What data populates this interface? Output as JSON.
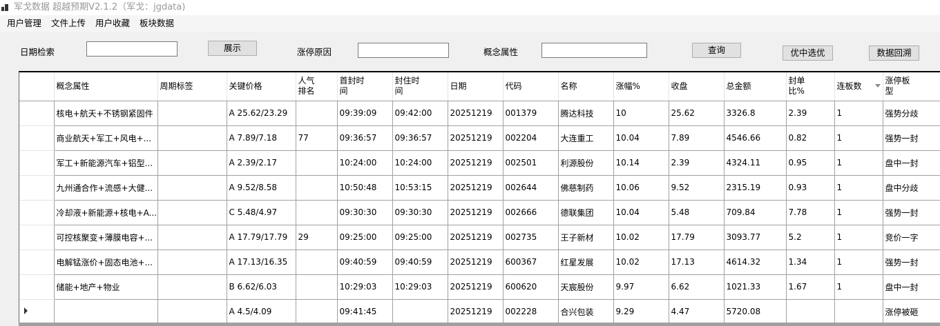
{
  "window": {
    "title": "军戈数据 超越预期V2.1.2（军戈：jgdata)"
  },
  "menu": [
    "用户管理",
    "文件上传",
    "用户收藏",
    "板块数据"
  ],
  "filters": {
    "date_label": "日期检索",
    "date_value": "",
    "show_button": "展示",
    "reason_label": "涨停原因",
    "reason_value": "",
    "concept_label": "概念属性",
    "concept_value": "",
    "query_button": "查询",
    "best_button": "优中选优",
    "backtrack_button": "数据回溯"
  },
  "table": {
    "columns": [
      "概念属性",
      "周期标签",
      "关键价格",
      "人气排名",
      "首封时间",
      "封住时间",
      "日期",
      "代码",
      "名称",
      "涨幅%",
      "收盘",
      "总金额",
      "封单比%",
      "连板数",
      "涨停板型"
    ],
    "sorted_column": "连板数",
    "sort_direction": "descending",
    "rows": [
      [
        "核电+航天+不锈钢紧固件",
        "",
        "A 25.62/23.29",
        "",
        "09:39:09",
        "09:42:00",
        "20251219",
        "001379",
        "腾达科技",
        "10",
        "25.62",
        "3326.8",
        "2.39",
        "1",
        "强势分歧"
      ],
      [
        "商业航天+军工+风电+...",
        "",
        "A 7.89/7.18",
        "77",
        "09:36:57",
        "09:36:57",
        "20251219",
        "002204",
        "大连重工",
        "10.04",
        "7.89",
        "4546.66",
        "0.82",
        "1",
        "强势一封"
      ],
      [
        "军工+新能源汽车+铝型...",
        "",
        "A 2.39/2.17",
        "",
        "10:24:00",
        "10:24:00",
        "20251219",
        "002501",
        "利源股份",
        "10.14",
        "2.39",
        "4324.11",
        "0.95",
        "1",
        "盘中一封"
      ],
      [
        "九州通合作+流感+大健...",
        "",
        "A 9.52/8.58",
        "",
        "10:50:48",
        "10:53:15",
        "20251219",
        "002644",
        "佛慈制药",
        "10.06",
        "9.52",
        "2315.19",
        "0.93",
        "1",
        "盘中分歧"
      ],
      [
        "冷却液+新能源+核电+A...",
        "",
        "C 5.48/4.97",
        "",
        "09:30:30",
        "09:30:30",
        "20251219",
        "002666",
        "德联集团",
        "10.04",
        "5.48",
        "709.84",
        "7.78",
        "1",
        "强势一封"
      ],
      [
        "可控核聚变+薄膜电容+...",
        "",
        "A 17.79/17.79",
        "29",
        "09:25:00",
        "09:25:00",
        "20251219",
        "002735",
        "王子新材",
        "10.02",
        "17.79",
        "3093.77",
        "5.2",
        "1",
        "竞价一字"
      ],
      [
        "电解锰涨价+固态电池+...",
        "",
        "A 17.13/16.35",
        "",
        "09:40:59",
        "09:40:59",
        "20251219",
        "600367",
        "红星发展",
        "10.02",
        "17.13",
        "4614.32",
        "1.34",
        "1",
        "强势一封"
      ],
      [
        "储能+地产+物业",
        "",
        "B 6.62/6.03",
        "",
        "10:29:03",
        "10:29:03",
        "20251219",
        "600620",
        "天宸股份",
        "9.97",
        "6.62",
        "1021.33",
        "1.67",
        "1",
        "盘中一封"
      ],
      [
        "",
        "",
        "A 4.5/4.09",
        "",
        "09:41:45",
        "",
        "20251219",
        "002228",
        "合兴包装",
        "9.29",
        "4.47",
        "5720.08",
        "",
        "",
        "涨停被砸"
      ]
    ],
    "current_row": 8
  }
}
